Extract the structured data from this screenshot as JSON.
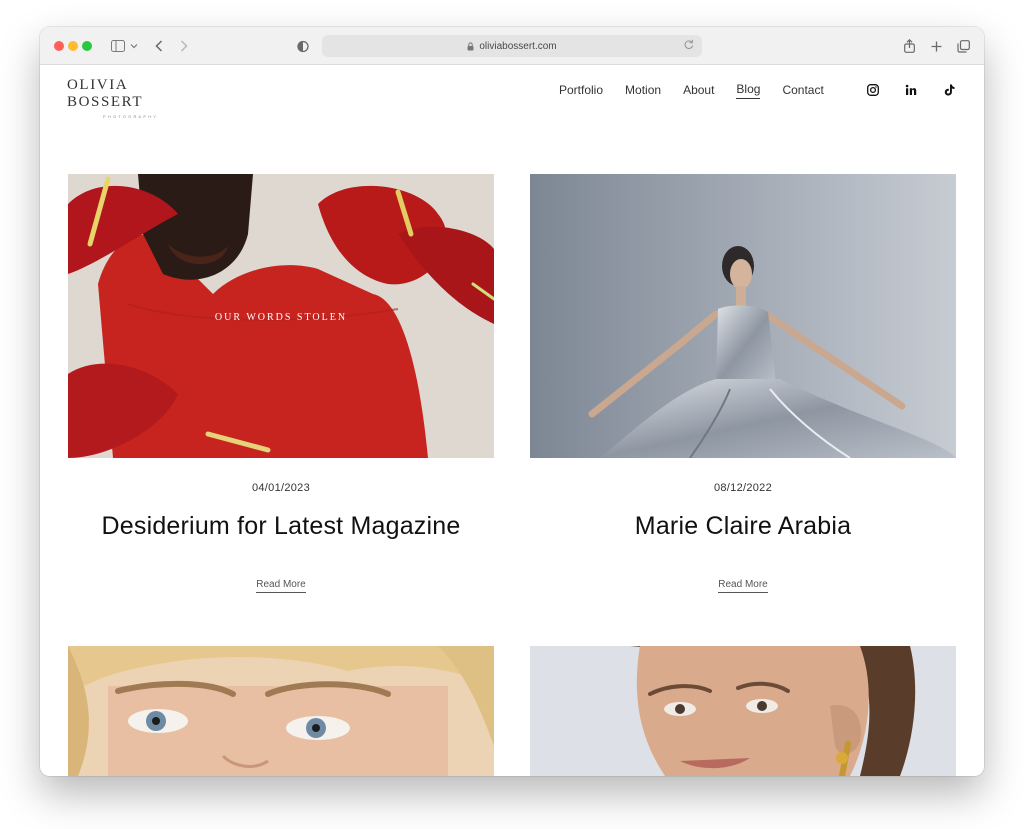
{
  "browser": {
    "url": "oliviabossert.com",
    "icons": [
      "sidebar-icon",
      "chevron-down-icon",
      "back-icon",
      "forward-icon",
      "privacy-shield-icon",
      "lock-icon",
      "reload-icon",
      "share-icon",
      "new-tab-icon",
      "tabs-icon"
    ]
  },
  "site": {
    "logo": {
      "name": "OLIVIA BOSSERT",
      "tagline": "PHOTOGRAPHY"
    },
    "nav": [
      {
        "label": "Portfolio",
        "active": false
      },
      {
        "label": "Motion",
        "active": false
      },
      {
        "label": "About",
        "active": false
      },
      {
        "label": "Blog",
        "active": true
      },
      {
        "label": "Contact",
        "active": false
      }
    ],
    "social": [
      "instagram-icon",
      "linkedin-icon",
      "tiktok-icon"
    ]
  },
  "posts": [
    {
      "overlay": "OUR WORDS STOLEN",
      "date": "04/01/2023",
      "title": "Desiderium for Latest Magazine",
      "read_more": "Read More"
    },
    {
      "date": "08/12/2022",
      "title": "Marie Claire Arabia",
      "read_more": "Read More"
    },
    {},
    {}
  ],
  "colors": {
    "accent_text": "#111111",
    "window_bg": "#f1f1f1"
  }
}
